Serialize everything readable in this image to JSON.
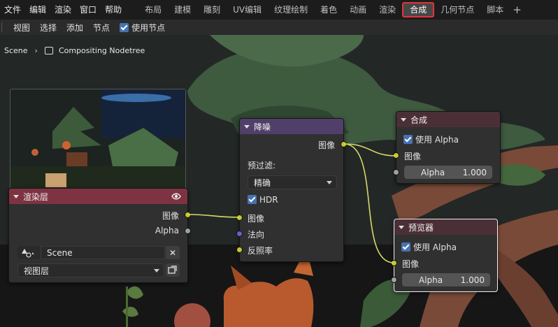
{
  "menus": [
    "文件",
    "编辑",
    "渲染",
    "窗口",
    "帮助"
  ],
  "workspace_tabs": [
    {
      "label": "布局",
      "active": false
    },
    {
      "label": "建模",
      "active": false
    },
    {
      "label": "雕刻",
      "active": false
    },
    {
      "label": "UV编辑",
      "active": false
    },
    {
      "label": "纹理绘制",
      "active": false
    },
    {
      "label": "着色",
      "active": false
    },
    {
      "label": "动画",
      "active": false
    },
    {
      "label": "渲染",
      "active": false
    },
    {
      "label": "合成",
      "active": true
    },
    {
      "label": "几何节点",
      "active": false
    },
    {
      "label": "脚本",
      "active": false
    }
  ],
  "add_tab_glyph": "+",
  "header": {
    "view": "视图",
    "select": "选择",
    "add": "添加",
    "node": "节点",
    "use_nodes": "使用节点"
  },
  "breadcrumb": {
    "scene": "Scene",
    "tree": "Compositing Nodetree"
  },
  "nodes": {
    "render_layers": {
      "title": "渲染层",
      "out_image": "图像",
      "out_alpha": "Alpha",
      "scene_value": "Scene",
      "view_layer": "视图层"
    },
    "denoise": {
      "title": "降噪",
      "out_image": "图像",
      "prefilter_label": "预过滤:",
      "prefilter_value": "精确",
      "hdr_label": "HDR",
      "in_image": "图像",
      "in_normal": "法向",
      "in_albedo": "反照率"
    },
    "composite": {
      "title": "合成",
      "use_alpha": "使用 Alpha",
      "in_image": "图像",
      "alpha_label": "Alpha",
      "alpha_value": "1.000"
    },
    "viewer": {
      "title": "预览器",
      "use_alpha": "使用 Alpha",
      "in_image": "图像",
      "alpha_label": "Alpha",
      "alpha_value": "1.000"
    }
  },
  "icons": [
    "eye-icon",
    "scene-icon",
    "close-icon",
    "browse-icon",
    "nodetree-icon",
    "chevron-right-icon"
  ],
  "colors": {
    "active_tab_outline": "#e8323c",
    "checkbox_blue": "#4772b3",
    "socket_image": "#c7c729",
    "socket_value": "#a1a1a1",
    "socket_vector": "#6363c7"
  }
}
